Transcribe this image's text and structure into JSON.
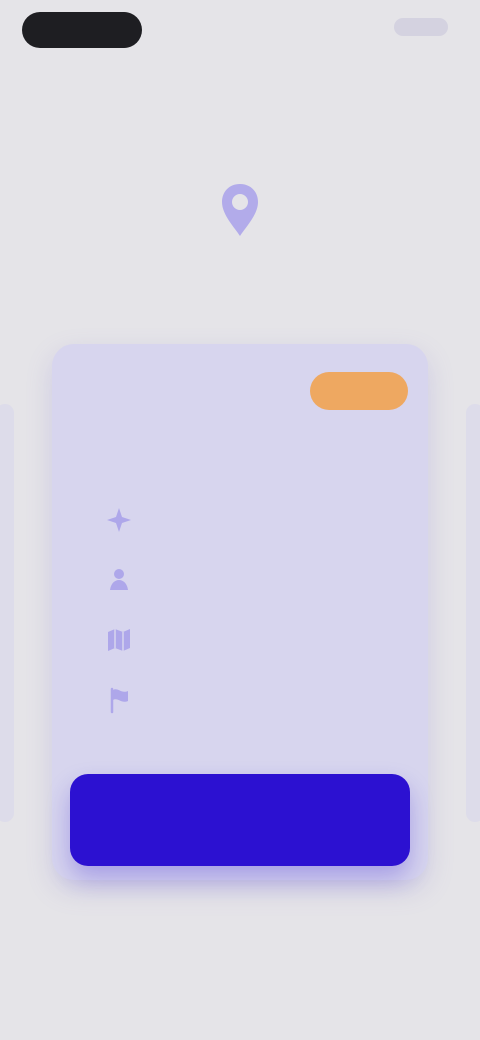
{
  "top": {
    "status_right": "",
    "skip_label": ""
  },
  "hero": {
    "line1_left": "",
    "line1_right": "",
    "line2": "",
    "icon": "location-pin-icon"
  },
  "offer": {
    "badge": "",
    "title": "",
    "subtitle": "",
    "features": [
      {
        "icon": "sparkle-icon",
        "text": ""
      },
      {
        "icon": "person-icon",
        "text": ""
      },
      {
        "icon": "map-icon",
        "text": ""
      },
      {
        "icon": "flag-icon",
        "text": ""
      }
    ],
    "note": "",
    "cta": ""
  },
  "footer": {
    "link": ""
  },
  "colors": {
    "background": "#e5e4e8",
    "accent": "#2c11d1",
    "headline": "#6f67d7",
    "card": "#d7d5ee",
    "badge": "#eea861"
  }
}
